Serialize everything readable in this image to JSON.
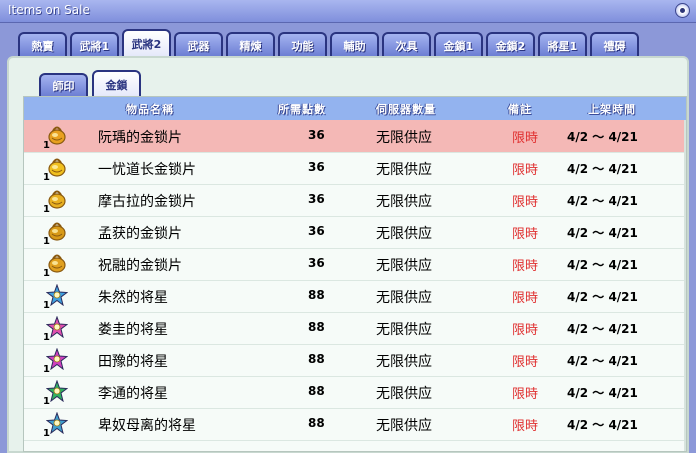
{
  "window": {
    "title": "Items on Sale"
  },
  "top_tabs": [
    {
      "label": "熱賣",
      "active": false
    },
    {
      "label": "武將1",
      "active": false
    },
    {
      "label": "武將2",
      "active": true
    },
    {
      "label": "武器",
      "active": false
    },
    {
      "label": "精煉",
      "active": false
    },
    {
      "label": "功能",
      "active": false
    },
    {
      "label": "輔助",
      "active": false
    },
    {
      "label": "次具",
      "active": false
    },
    {
      "label": "金鎖1",
      "active": false
    },
    {
      "label": "金鎖2",
      "active": false
    },
    {
      "label": "將星1",
      "active": false
    },
    {
      "label": "禮碍",
      "active": false
    }
  ],
  "sub_tabs": [
    {
      "label": "師印",
      "active": false
    },
    {
      "label": "金鎖",
      "active": true
    }
  ],
  "columns": {
    "name": "物品名稱",
    "price": "所需點數",
    "stock": "伺服器數量",
    "note": "備註",
    "time": "上架時間"
  },
  "rows": [
    {
      "icon": "gold-lock-icon",
      "qty": "1",
      "name": "阮瑀的金锁片",
      "price": "36",
      "stock": "无限供应",
      "note": "限時",
      "time": "4/2 ～ 4/21",
      "selected": true,
      "color": "#e8a020"
    },
    {
      "icon": "gold-lock-icon",
      "qty": "1",
      "name": "一忧道长金锁片",
      "price": "36",
      "stock": "无限供应",
      "note": "限時",
      "time": "4/2 ～ 4/21",
      "selected": false,
      "color": "#f0c020"
    },
    {
      "icon": "gold-lock-icon",
      "qty": "1",
      "name": "摩古拉的金锁片",
      "price": "36",
      "stock": "无限供应",
      "note": "限時",
      "time": "4/2 ～ 4/21",
      "selected": false,
      "color": "#e8b020"
    },
    {
      "icon": "gold-lock-icon",
      "qty": "1",
      "name": "孟获的金锁片",
      "price": "36",
      "stock": "无限供应",
      "note": "限時",
      "time": "4/2 ～ 4/21",
      "selected": false,
      "color": "#d89a18"
    },
    {
      "icon": "gold-lock-icon",
      "qty": "1",
      "name": "祝融的金锁片",
      "price": "36",
      "stock": "无限供应",
      "note": "限時",
      "time": "4/2 ～ 4/21",
      "selected": false,
      "color": "#e0a020"
    },
    {
      "icon": "general-star-icon",
      "qty": "1",
      "name": "朱然的将星",
      "price": "88",
      "stock": "无限供应",
      "note": "限時",
      "time": "4/2 ～ 4/21",
      "selected": false,
      "color": "#3fa0e0"
    },
    {
      "icon": "general-star-icon",
      "qty": "1",
      "name": "娄圭的将星",
      "price": "88",
      "stock": "无限供应",
      "note": "限時",
      "time": "4/2 ～ 4/21",
      "selected": false,
      "color": "#e04fb0"
    },
    {
      "icon": "general-star-icon",
      "qty": "1",
      "name": "田豫的将星",
      "price": "88",
      "stock": "无限供应",
      "note": "限時",
      "time": "4/2 ～ 4/21",
      "selected": false,
      "color": "#d040c0"
    },
    {
      "icon": "general-star-icon",
      "qty": "1",
      "name": "李通的将星",
      "price": "88",
      "stock": "无限供应",
      "note": "限時",
      "time": "4/2 ～ 4/21",
      "selected": false,
      "color": "#30b060"
    },
    {
      "icon": "general-star-icon",
      "qty": "1",
      "name": "卑奴母离的将星",
      "price": "88",
      "stock": "无限供应",
      "note": "限時",
      "time": "4/2 ～ 4/21",
      "selected": false,
      "color": "#40a0d0"
    }
  ]
}
